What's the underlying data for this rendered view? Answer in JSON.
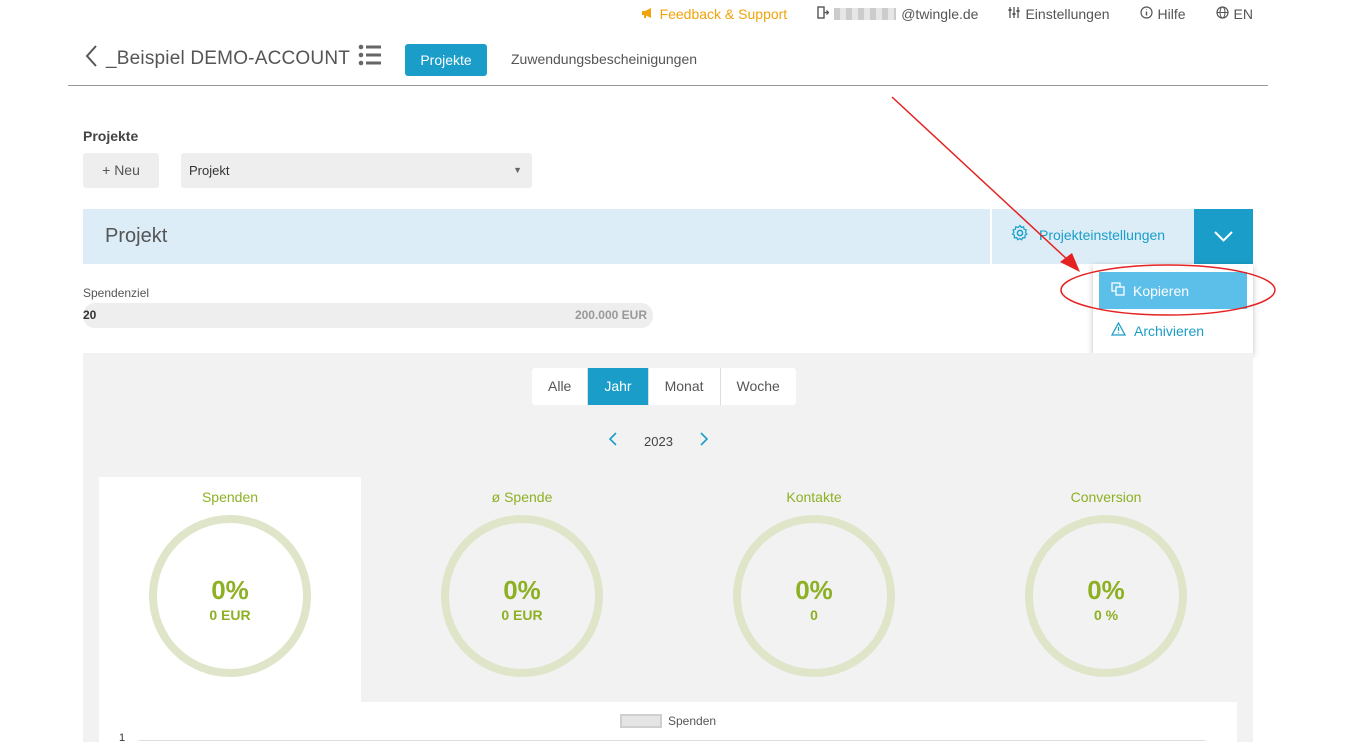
{
  "topbar": {
    "feedback": "Feedback & Support",
    "email_suffix": "@twingle.de",
    "settings": "Einstellungen",
    "help": "Hilfe",
    "lang": "EN"
  },
  "header": {
    "account": "_Beispiel DEMO-ACCOUNT",
    "tab_projects": "Projekte",
    "tab_receipts": "Zuwendungsbescheinigungen"
  },
  "projects_section": {
    "label": "Projekte",
    "new_button": "Neu",
    "select_value": "Projekt"
  },
  "project_bar": {
    "title": "Projekt",
    "settings": "Projekteinstellungen"
  },
  "dropdown_menu": {
    "copy": "Kopieren",
    "archive": "Archivieren"
  },
  "goal": {
    "label": "Spendenziel",
    "current": "20",
    "target": "200.000 EUR"
  },
  "period_tabs": [
    "Alle",
    "Jahr",
    "Monat",
    "Woche"
  ],
  "year_nav": {
    "year": "2023"
  },
  "kpis": [
    {
      "title": "Spenden",
      "percent": "0%",
      "value": "0 EUR"
    },
    {
      "title": "ø Spende",
      "percent": "0%",
      "value": "0 EUR"
    },
    {
      "title": "Kontakte",
      "percent": "0%",
      "value": "0"
    },
    {
      "title": "Conversion",
      "percent": "0%",
      "value": "0 %"
    }
  ],
  "chart": {
    "legend": "Spenden",
    "y_tick": "1"
  },
  "colors": {
    "accent": "#1a9ec9",
    "kpi_green": "#8db024",
    "feedback": "#f0a30a",
    "annotation": "#e52222"
  }
}
